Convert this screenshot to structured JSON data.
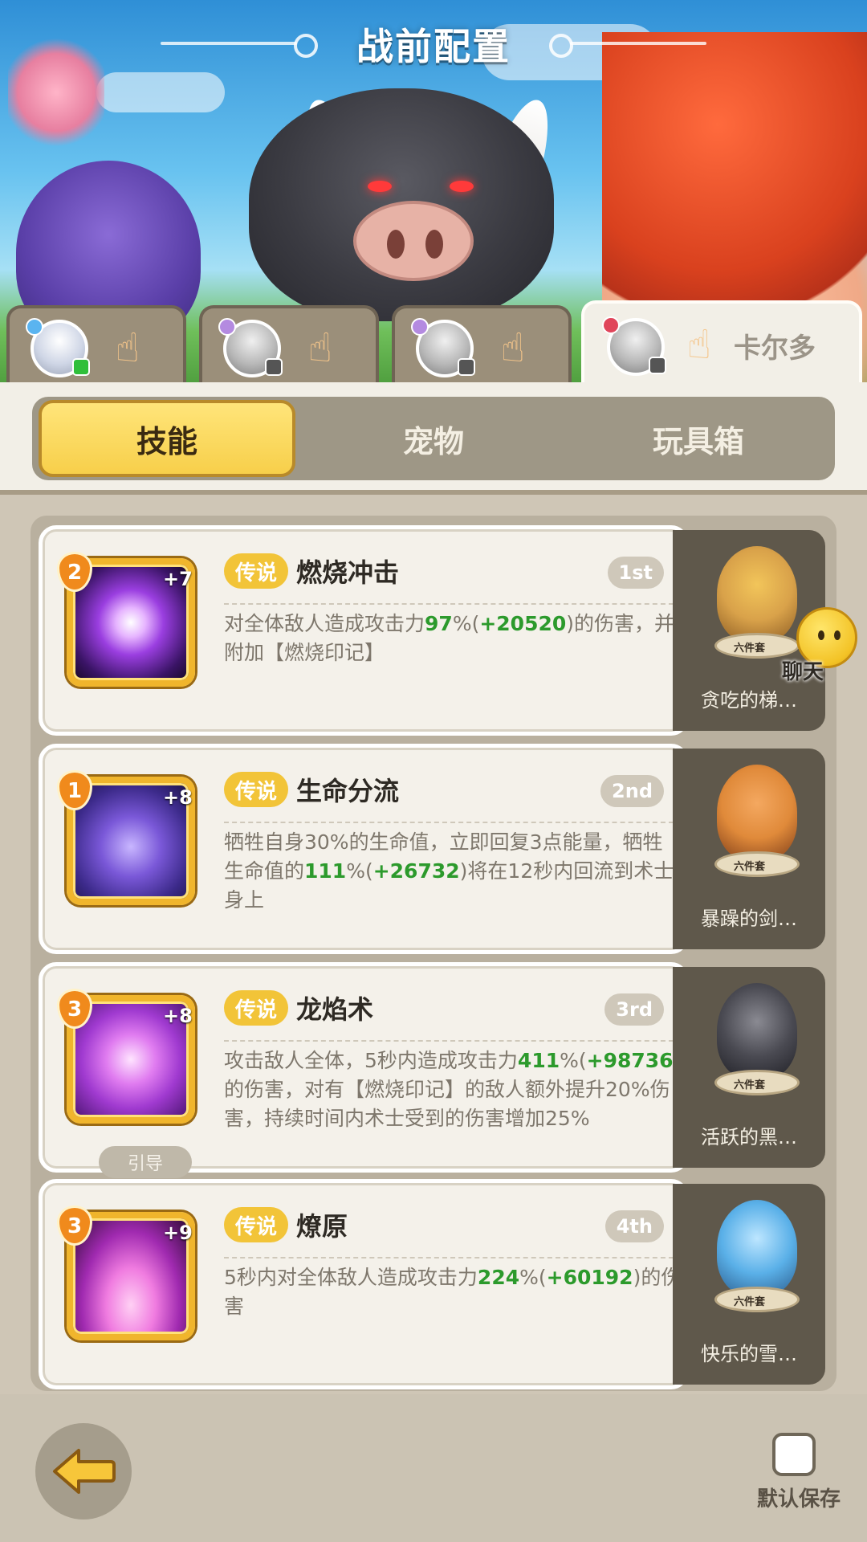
{
  "header": {
    "title": "战前配置"
  },
  "characters": [
    {
      "name": "",
      "status_color": "#2fbf3a",
      "badge_color": "#5ab4f0"
    },
    {
      "name": "",
      "status_color": "#555555",
      "badge_color": "#b48ae0"
    },
    {
      "name": "",
      "status_color": "#555555",
      "badge_color": "#b48ae0"
    },
    {
      "name": "卡尔多",
      "status_color": "#555555",
      "badge_color": "#e0455a"
    }
  ],
  "tabs": [
    {
      "label": "技能",
      "active": true
    },
    {
      "label": "宠物",
      "active": false
    },
    {
      "label": "玩具箱",
      "active": false
    }
  ],
  "skills": [
    {
      "level": "2",
      "plus": "+7",
      "rarity": "传说",
      "name": "燃烧冲击",
      "rank": "1st",
      "desc_parts": [
        {
          "t": "对全体敌人造成攻击力"
        },
        {
          "t": "97",
          "g": true
        },
        {
          "t": "%("
        },
        {
          "t": "+20520",
          "g": true
        },
        {
          "t": ")的伤害，并附加【燃烧印记】"
        }
      ],
      "guide": "",
      "pet": {
        "name": "贪吃的梯…",
        "tag": "六件套",
        "color": "#d9a24a"
      }
    },
    {
      "level": "1",
      "plus": "+8",
      "rarity": "传说",
      "name": "生命分流",
      "rank": "2nd",
      "desc_parts": [
        {
          "t": "牺牲自身30%的生命值，立即回复3点能量，牺牲生命值的"
        },
        {
          "t": "111",
          "g": true
        },
        {
          "t": "%("
        },
        {
          "t": "+26732",
          "g": true
        },
        {
          "t": ")将在12秒内回流到术士身上"
        }
      ],
      "guide": "",
      "pet": {
        "name": "暴躁的剑…",
        "tag": "六件套",
        "color": "#e08a3a"
      }
    },
    {
      "level": "3",
      "plus": "+8",
      "rarity": "传说",
      "name": "龙焰术",
      "rank": "3rd",
      "desc_parts": [
        {
          "t": "攻击敌人全体，5秒内造成攻击力"
        },
        {
          "t": "411",
          "g": true
        },
        {
          "t": "%("
        },
        {
          "t": "+98736",
          "g": true
        },
        {
          "t": ")的伤害，对有【燃烧印记】的敌人额外提升20%伤害，持续时间内术士受到的伤害增加25%"
        }
      ],
      "guide": "引导",
      "pet": {
        "name": "活跃的黑…",
        "tag": "六件套",
        "color": "#4a4a52"
      }
    },
    {
      "level": "3",
      "plus": "+9",
      "rarity": "传说",
      "name": "燎原",
      "rank": "4th",
      "desc_parts": [
        {
          "t": "5秒内对全体敌人造成攻击力"
        },
        {
          "t": "224",
          "g": true
        },
        {
          "t": "%("
        },
        {
          "t": "+60192",
          "g": true
        },
        {
          "t": ")的伤害"
        }
      ],
      "guide": "",
      "pet": {
        "name": "快乐的雪…",
        "tag": "六件套",
        "color": "#5ab0e8"
      }
    }
  ],
  "chat": {
    "label": "聊天"
  },
  "bottom": {
    "save_label": "默认保存"
  },
  "colors": {
    "accent": "#f7cf4a",
    "highlight_green": "#2c9a2c",
    "rarity_gold": "#f2c438"
  }
}
